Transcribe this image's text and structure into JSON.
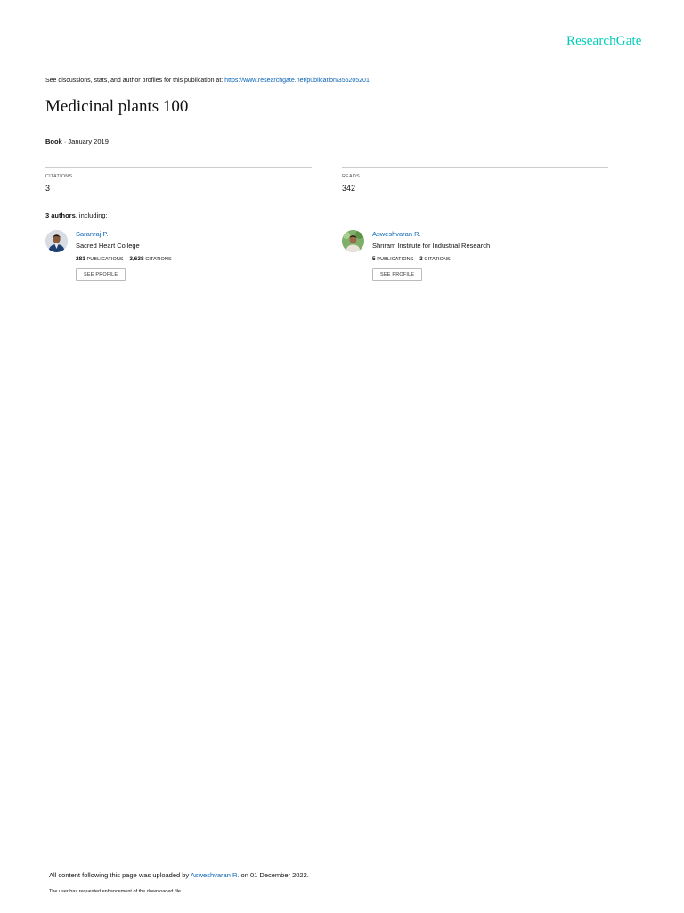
{
  "logo": "ResearchGate",
  "header": {
    "see_text": "See discussions, stats, and author profiles for this publication at: ",
    "url": "https://www.researchgate.net/publication/355205201"
  },
  "title": "Medicinal plants 100",
  "meta": {
    "type": "Book",
    "date": " · January 2019"
  },
  "citations": {
    "label": "CITATIONS",
    "value": "3"
  },
  "reads": {
    "label": "READS",
    "value": "342"
  },
  "authors_intro": {
    "count": "3 authors",
    "rest": ", including:"
  },
  "authors": [
    {
      "name": "Saranraj P.",
      "institution": "Sacred Heart College",
      "publications": "281",
      "publications_label": "PUBLICATIONS",
      "citations": "3,638",
      "citations_label": "CITATIONS",
      "button": "SEE PROFILE"
    },
    {
      "name": "Asweshvaran R.",
      "institution": "Shriram Institute for Industrial Research",
      "publications": "5",
      "publications_label": "PUBLICATIONS",
      "citations": "3",
      "citations_label": "CITATIONS",
      "button": "SEE PROFILE"
    }
  ],
  "footer": {
    "prefix": "All content following this page was uploaded by ",
    "uploader": "Asweshvaran R.",
    "suffix": " on 01 December 2022.",
    "note": "The user has requested enhancement of the downloaded file."
  },
  "colors": {
    "brand": "#00ccbb",
    "link": "#0a64b3"
  }
}
